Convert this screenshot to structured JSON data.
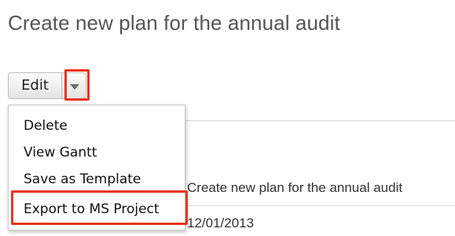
{
  "page": {
    "title": "Create new plan for the annual audit"
  },
  "toolbar": {
    "edit_label": "Edit"
  },
  "menu": {
    "items": [
      {
        "label": "Delete"
      },
      {
        "label": "View Gantt"
      },
      {
        "label": "Save as Template"
      },
      {
        "label": "Export to MS Project"
      }
    ]
  },
  "details": {
    "name_value": "Create new plan for the annual audit",
    "date_value": "12/01/2013"
  },
  "colors": {
    "highlight": "#e8341c"
  }
}
